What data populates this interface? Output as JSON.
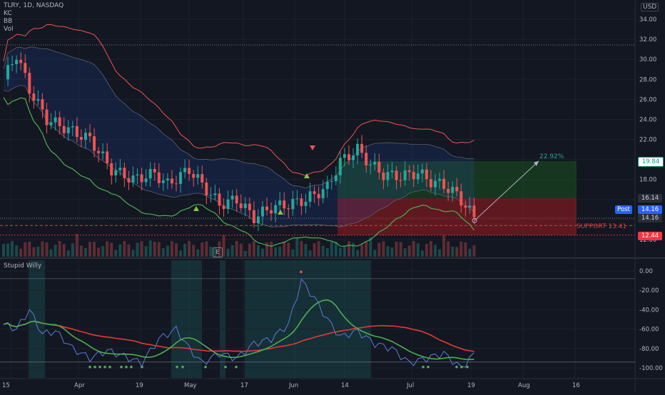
{
  "legend": {
    "symbol": "TLRY, 1D, NASDAQ",
    "items": [
      "KC",
      "BB",
      "Vol"
    ]
  },
  "currency": "USD",
  "indicator_title": "Stupid Willy",
  "earnings_badge": "E",
  "annotations": {
    "support": "SUPPORT 13.41",
    "gain_pct": "22.92%",
    "post_label": "Post"
  },
  "price_tags": [
    {
      "text": "19.84",
      "bg": "#ffffff",
      "fg": "#089981",
      "border": "#089981"
    },
    {
      "text": "16.14",
      "bg": "#2a2e39",
      "fg": "#d1d4dc",
      "border": "#2a2e39"
    },
    {
      "text": "14.16",
      "bg": "#2a2e39",
      "fg": "#d1d4dc",
      "border": "#2a2e39"
    },
    {
      "text": "14.16",
      "bg": "#2a2e39",
      "fg": "#d1d4dc",
      "border": "#2a2e39"
    },
    {
      "text": "12.44",
      "bg": "#f23645",
      "fg": "#ffffff",
      "border": "#f23645"
    }
  ],
  "price_axis_labels": [
    "34.00",
    "32.00",
    "30.00",
    "28.00",
    "26.00",
    "24.00",
    "22.00",
    "20.00",
    "18.00",
    "14.00",
    "12.00"
  ],
  "indicator_axis_labels": [
    "0.00",
    "-20.00",
    "-40.00",
    "-60.00",
    "-80.00",
    "-100.00"
  ],
  "time_axis_labels": [
    "15",
    "Apr",
    "19",
    "May",
    "17",
    "Jun",
    "14",
    "Jul",
    "19",
    "Aug",
    "16"
  ],
  "colors": {
    "background": "#131722",
    "up": "#26a69a",
    "down": "#ef5350",
    "bb_upper": "#ef5350",
    "bb_lower": "#4caf50",
    "green_box": "#1b5e20",
    "red_box": "#b71c1c",
    "kc_line": "#5d606b",
    "willy_fast": "#5c7bd9",
    "willy_signal": "#4caf50",
    "willy_slow": "#e53935"
  },
  "chart_data": {
    "type": "candlestick",
    "price_scale": {
      "min": 11,
      "max": 35
    },
    "indicator_scale": {
      "min": -105,
      "max": 2
    },
    "support": 13.41,
    "entry": 14.16,
    "target": 19.84,
    "stop": 12.44,
    "gain": 22.92
  }
}
